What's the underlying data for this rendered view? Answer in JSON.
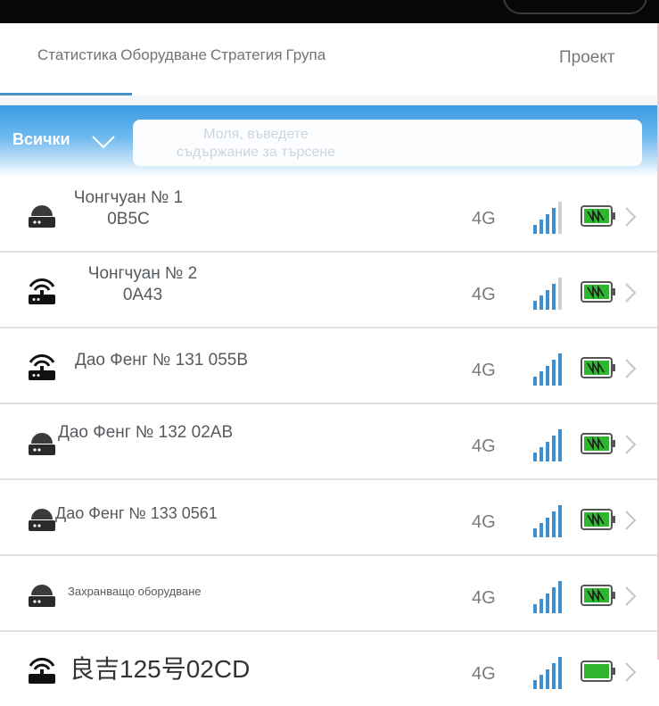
{
  "tabs": {
    "items": [
      "Статистика",
      "Оборудване",
      "Стратегия",
      "Група"
    ],
    "project": "Проект"
  },
  "filter": {
    "all_label": "Всички",
    "search_placeholder_line1": "Моля, въведете",
    "search_placeholder_line2": "съдържание за търсене"
  },
  "devices": [
    {
      "line1": "Чонгчуан № 1",
      "line2": "0B5C",
      "network": "4G",
      "icon": "camera-icon"
    },
    {
      "line1": "Чонгчуан № 2",
      "line2": "0A43",
      "network": "4G",
      "icon": "router-icon"
    },
    {
      "line1": "Дао Фенг № 131 055B",
      "line2": "",
      "network": "4G",
      "icon": "router-icon"
    },
    {
      "line1": "Дао Фенг № 132 02AB",
      "line2": "",
      "network": "4G",
      "icon": "camera-icon"
    },
    {
      "line1": "Дао Фенг № 133 0561",
      "line2": "",
      "network": "4G",
      "icon": "camera-icon"
    },
    {
      "line1": "Захранващо оборудване",
      "line2": "",
      "network": "4G",
      "icon": "camera-icon"
    },
    {
      "line1": "良吉125号02CD",
      "line2": "",
      "network": "4G",
      "icon": "router-icon"
    }
  ],
  "colors": {
    "accent": "#4a90c2",
    "signal": "#3d8fd0",
    "battery": "#2fb52f"
  }
}
